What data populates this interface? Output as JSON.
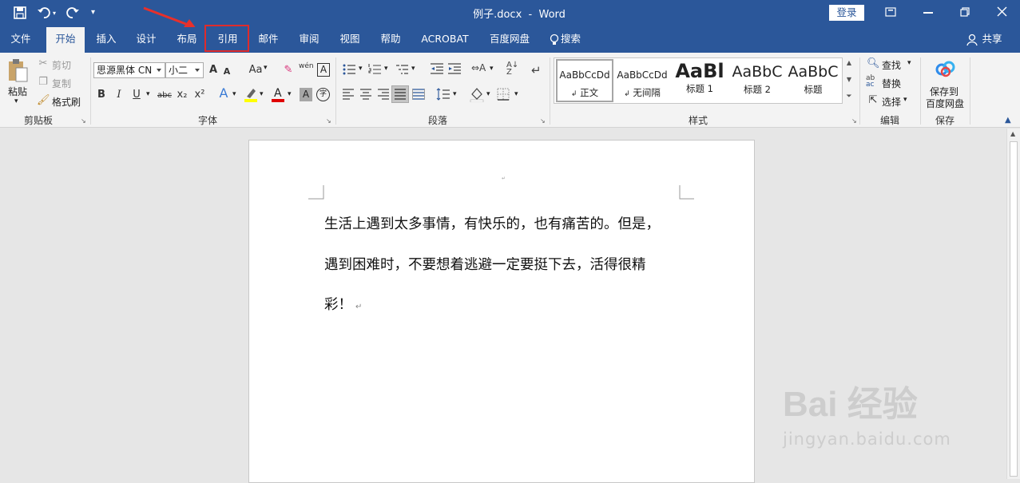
{
  "title_bar": {
    "doc_title": "例子.docx  -  Word",
    "login_label": "登录"
  },
  "tabs": {
    "file": "文件",
    "home": "开始",
    "insert": "插入",
    "design": "设计",
    "layout": "布局",
    "references": "引用",
    "mailings": "邮件",
    "review": "审阅",
    "view": "视图",
    "help": "帮助",
    "acrobat": "ACROBAT",
    "baidu": "百度网盘",
    "search": "搜索",
    "share": "共享"
  },
  "clipboard": {
    "paste": "粘贴",
    "cut": "剪切",
    "copy": "复制",
    "format_painter": "格式刷",
    "label": "剪贴板"
  },
  "font": {
    "name": "思源黑体 CN",
    "size": "小二",
    "label": "字体",
    "bold": "B",
    "italic": "I",
    "underline": "U",
    "strike": "abc",
    "sub": "x₂",
    "sup": "x²",
    "grow": "A",
    "shrink": "A",
    "case": "Aa",
    "clear": "A",
    "wen": "wén",
    "phon": "A",
    "charshade": "A",
    "charborder": "A",
    "circled": "字"
  },
  "paragraph": {
    "label": "段落"
  },
  "styles": {
    "label": "样式",
    "items": [
      {
        "preview": "AaBbCcDd",
        "name": "正文"
      },
      {
        "preview": "AaBbCcDd",
        "name": "无间隔"
      },
      {
        "preview": "AaBl",
        "name": "标题 1"
      },
      {
        "preview": "AaBbC",
        "name": "标题 2"
      },
      {
        "preview": "AaBbC",
        "name": "标题"
      }
    ]
  },
  "editing": {
    "find": "查找",
    "replace": "替换",
    "select": "选择",
    "label": "编辑"
  },
  "save": {
    "button": "保存到\n百度网盘",
    "line1": "保存到",
    "line2": "百度网盘",
    "label": "保存"
  },
  "document": {
    "line1": "生活上遇到太多事情，有快乐的，也有痛苦的。但是，",
    "line2": "遇到困难时，不要想着逃避一定要挺下去，活得很精",
    "line3": "彩！"
  },
  "colors": {
    "accent": "#2b579a",
    "highlight_box": "#e02b2b"
  },
  "watermark": {
    "text": "Bai 经验",
    "url": "jingyan.baidu.com"
  }
}
